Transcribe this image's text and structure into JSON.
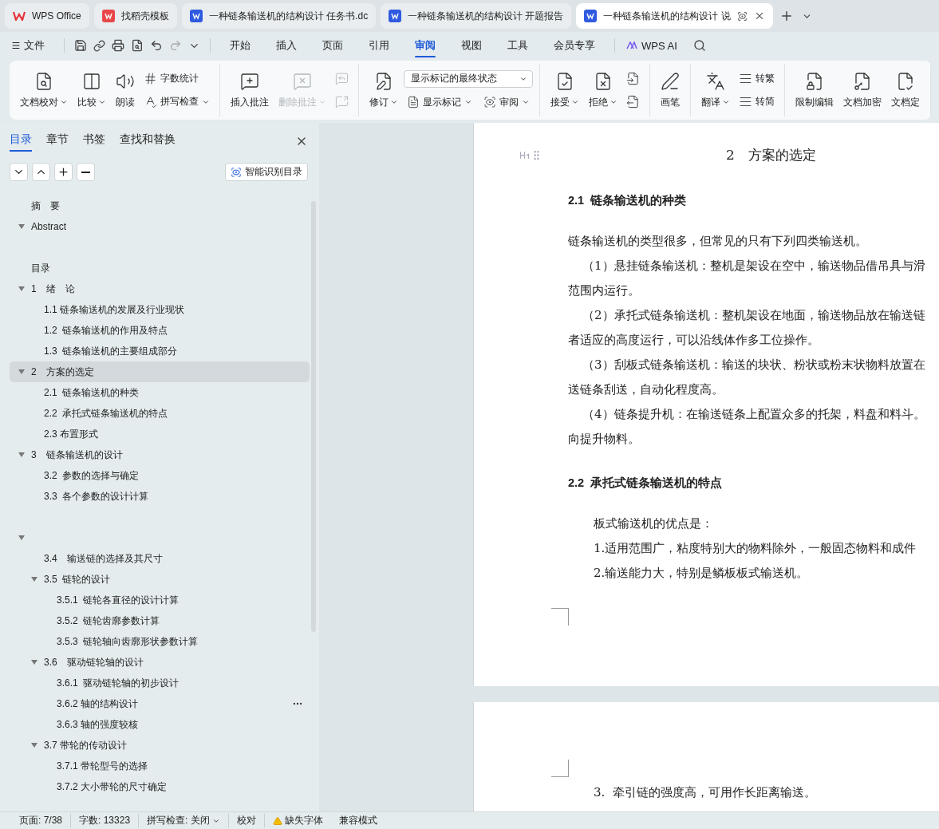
{
  "title_tabs": [
    {
      "label": "WPS Office",
      "kind": "home",
      "selected": false
    },
    {
      "label": "找稻壳模板",
      "kind": "template",
      "selected": false
    },
    {
      "label": "一种链条输送机的结构设计 任务书.dc",
      "kind": "doc",
      "selected": false
    },
    {
      "label": "一种链条输送机的结构设计 开题报告",
      "kind": "doc",
      "selected": false
    },
    {
      "label": "一种链条输送机的结构设计 说",
      "kind": "doc",
      "selected": true
    }
  ],
  "menu": {
    "file": "文件",
    "tabs": [
      {
        "label": "开始",
        "selected": false
      },
      {
        "label": "插入",
        "selected": false
      },
      {
        "label": "页面",
        "selected": false
      },
      {
        "label": "引用",
        "selected": false
      },
      {
        "label": "审阅",
        "selected": true
      },
      {
        "label": "视图",
        "selected": false
      },
      {
        "label": "工具",
        "selected": false
      },
      {
        "label": "会员专享",
        "selected": false
      }
    ],
    "ai": "WPS AI"
  },
  "ribbon": [
    {
      "items": [
        {
          "kind": "big",
          "label": "文档校对",
          "caret": true,
          "disabled": false
        },
        {
          "kind": "big",
          "label": "比较",
          "caret": true,
          "disabled": false
        },
        {
          "kind": "big",
          "label": "朗读",
          "caret": false,
          "disabled": false
        },
        {
          "kind": "stack",
          "rows": [
            {
              "label": "字数统计",
              "caret": false,
              "disabled": false
            },
            {
              "label": "拼写检查",
              "caret": true,
              "disabled": false
            }
          ]
        }
      ]
    },
    {
      "items": [
        {
          "kind": "big",
          "label": "插入批注",
          "caret": false,
          "disabled": false
        },
        {
          "kind": "big",
          "label": "删除批注",
          "caret": true,
          "disabled": true
        },
        {
          "kind": "stack",
          "rows": [
            {
              "caret": false,
              "disabled": true
            },
            {
              "caret": false,
              "disabled": true
            }
          ]
        }
      ]
    },
    {
      "items": [
        {
          "kind": "big",
          "label": "修订",
          "caret": true,
          "disabled": false
        },
        {
          "kind": "combo",
          "select": "显示标记的最终状态",
          "rows": [
            {
              "label": "显示标记",
              "caret": true,
              "disabled": false
            },
            {
              "label": "审阅",
              "caret": true,
              "disabled": false
            }
          ]
        }
      ]
    },
    {
      "items": [
        {
          "kind": "big",
          "label": "接受",
          "caret": true,
          "disabled": false
        },
        {
          "kind": "big",
          "label": "拒绝",
          "caret": true,
          "disabled": false
        },
        {
          "kind": "stack",
          "rows": [
            {
              "caret": false,
              "disabled": false
            },
            {
              "caret": false,
              "disabled": false
            }
          ]
        }
      ]
    },
    {
      "items": [
        {
          "kind": "big",
          "label": "画笔",
          "caret": false,
          "disabled": false
        }
      ]
    },
    {
      "items": [
        {
          "kind": "big",
          "label": "翻译",
          "caret": true,
          "disabled": false
        },
        {
          "kind": "stack",
          "rows": [
            {
              "label": "转繁",
              "caret": false,
              "disabled": false
            },
            {
              "label": "转简",
              "caret": false,
              "disabled": false
            }
          ]
        }
      ]
    },
    {
      "items": [
        {
          "kind": "big",
          "label": "限制编辑",
          "caret": false,
          "disabled": false
        },
        {
          "kind": "big",
          "label": "文档加密",
          "caret": false,
          "disabled": false
        },
        {
          "kind": "big",
          "label": "文档定",
          "caret": false,
          "disabled": false
        }
      ]
    }
  ],
  "sidebar": {
    "tabs": [
      {
        "label": "目录",
        "selected": true
      },
      {
        "label": "章节",
        "selected": false
      },
      {
        "label": "书签",
        "selected": false
      },
      {
        "label": "查找和替换",
        "selected": false
      }
    ],
    "smart_button": "智能识别目录",
    "outline": [
      {
        "label": "摘　要",
        "selected": false
      },
      {
        "label": "Abstract",
        "expanded": true,
        "selected": false
      },
      {
        "selected": false
      },
      {
        "label": "目录",
        "selected": false
      },
      {
        "label": "1　绪　论",
        "expanded": true,
        "selected": false,
        "children": [
          {
            "label": "1.1 链条输送机的发展及行业现状",
            "selected": false
          },
          {
            "label": "1.2  链条输送机的作用及特点",
            "selected": false
          },
          {
            "label": "1.3  链条输送机的主要组成部分",
            "selected": false
          }
        ]
      },
      {
        "label": "2　方案的选定",
        "expanded": true,
        "selected": true,
        "children": [
          {
            "label": "2.1  链条输送机的种类",
            "selected": false
          },
          {
            "label": "2.2  承托式链条输送机的特点",
            "selected": false
          },
          {
            "label": "2.3 布置形式",
            "selected": false
          }
        ]
      },
      {
        "label": "3　链条输送机的设计",
        "expanded": true,
        "selected": false,
        "children": [
          {
            "label": "3.2  参数的选择与确定",
            "selected": false
          },
          {
            "label": "3.3  各个参数的设计计算",
            "selected": false
          },
          {
            "selected": false
          }
        ]
      },
      {
        "expanded": true,
        "selected": false,
        "children": [
          {
            "label": "3.4　输送链的选择及其尺寸",
            "selected": false
          },
          {
            "label": "3.5  链轮的设计",
            "expanded": true,
            "selected": false,
            "children": [
              {
                "label": "3.5.1  链轮各直径的设计计算",
                "selected": false
              },
              {
                "label": "3.5.2  链轮齿廓参数计算",
                "selected": false
              },
              {
                "label": "3.5.3  链轮轴向齿廓形状参数计算",
                "selected": false
              }
            ]
          },
          {
            "label": "3.6　驱动链轮轴的设计",
            "expanded": true,
            "selected": false,
            "children": [
              {
                "label": "3.6.1  驱动链轮轴的初步设计",
                "selected": false
              },
              {
                "label": "3.6.2 轴的结构设计",
                "selected": false,
                "hovered": true
              },
              {
                "label": "3.6.3 轴的强度较核",
                "selected": false
              }
            ]
          },
          {
            "label": "3.7 带轮的传动设计",
            "expanded": true,
            "selected": false,
            "children": [
              {
                "label": "3.7.1 带轮型号的选择",
                "selected": false
              },
              {
                "label": "3.7.2 大小带轮的尺寸确定",
                "selected": false
              }
            ]
          }
        ]
      }
    ]
  },
  "document": {
    "pages": [
      {
        "heading": "2　方案的选定",
        "blocks": [
          {
            "kind": "h2",
            "text": "2.1  链条输送机的种类"
          },
          {
            "kind": "plain",
            "text": "链条输送机的类型很多，但常见的只有下列四类输送机。"
          },
          {
            "kind": "indented",
            "text": "（1）悬挂链条输送机：整机是架设在空中，输送物品借吊具与滑"
          },
          {
            "kind": "plain",
            "text": "范围内运行。"
          },
          {
            "kind": "indented",
            "text": "（2）承托式链条输送机：整机架设在地面，输送物品放在输送链"
          },
          {
            "kind": "plain",
            "text": "者适应的高度运行，可以沿线体作多工位操作。"
          },
          {
            "kind": "indented",
            "text": "（3）刮板式链条输送机：输送的块状、粉状或粉末状物料放置在"
          },
          {
            "kind": "plain",
            "text": "送链条刮送，自动化程度高。"
          },
          {
            "kind": "indented",
            "text": "（4）链条提升机：在输送链条上配置众多的托架，料盘和料斗。"
          },
          {
            "kind": "plain",
            "text": "向提升物料。"
          },
          {
            "kind": "h2",
            "text": "2.2  承托式链条输送机的特点"
          },
          {
            "kind": "list",
            "text": "板式输送机的优点是："
          },
          {
            "kind": "list",
            "text": "1.适用范围广，粘度特别大的物料除外，一般固态物料和成件"
          },
          {
            "kind": "list",
            "text": "2.输送能力大，特别是鳞板板式输送机。"
          }
        ]
      },
      {
        "blocks": [
          {
            "kind": "list",
            "text": "3.  牵引链的强度高，可用作长距离输送。"
          }
        ]
      }
    ]
  },
  "status": {
    "page": "页面: 7/38",
    "words": "字数: 13323",
    "spell": "拼写检查: 关闭",
    "proof": "校对",
    "missing_font": "缺失字体",
    "compat": "兼容模式"
  }
}
